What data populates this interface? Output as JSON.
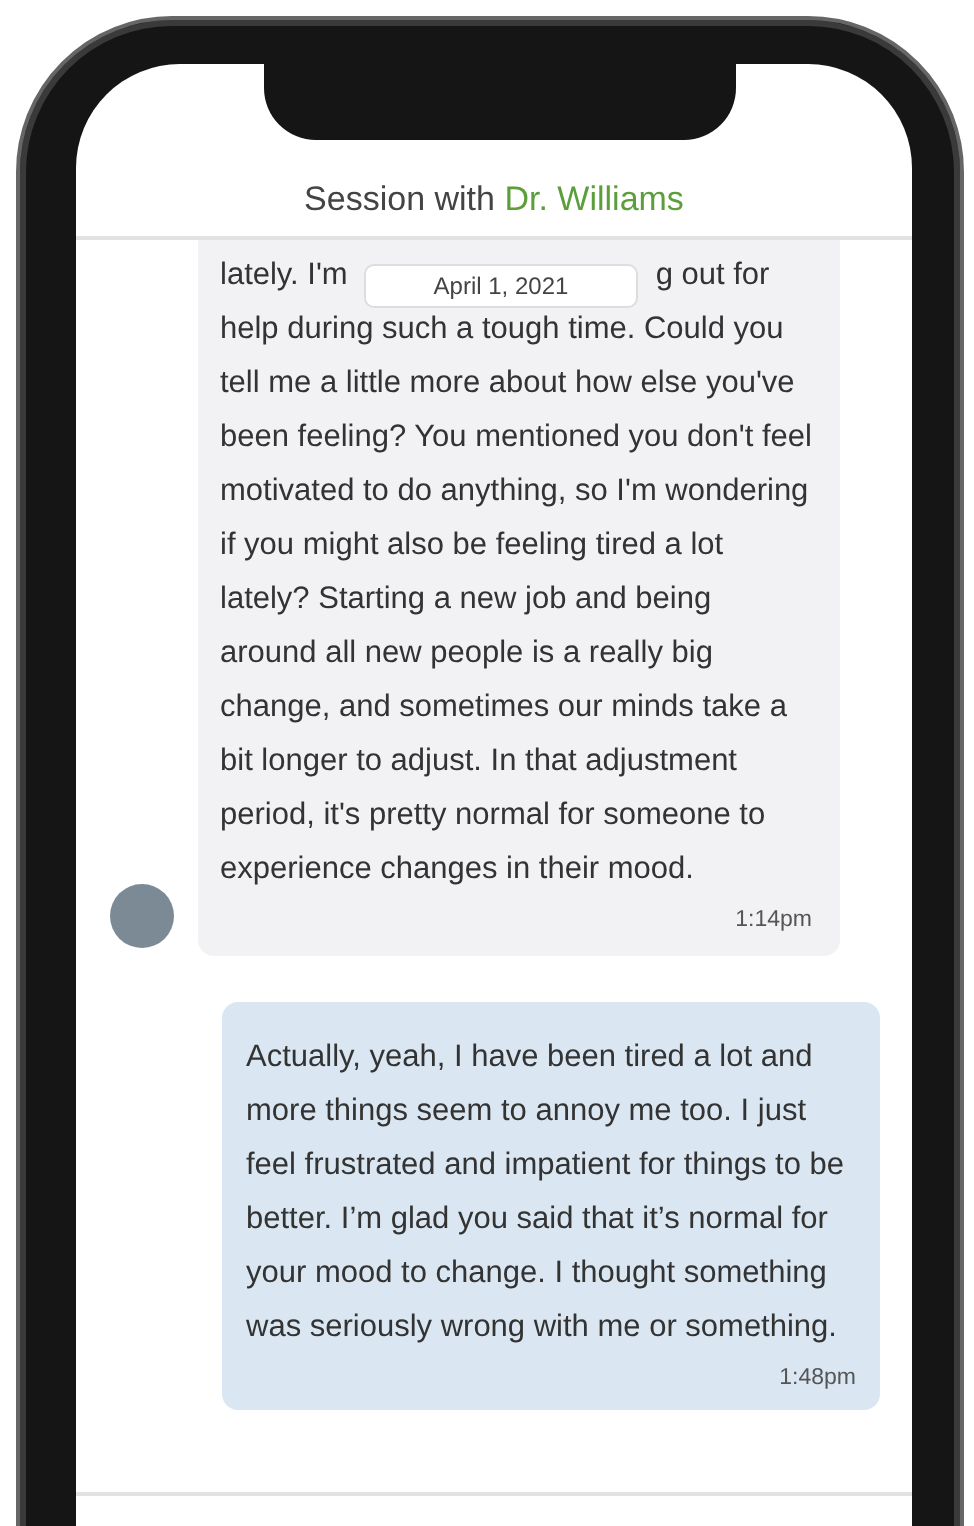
{
  "header": {
    "title": "Session with",
    "name": "Dr. Williams"
  },
  "date_badge": "April 1, 2021",
  "messages": [
    {
      "kind": "received",
      "top_fragments": [
        "lately. I'm",
        "g out for"
      ],
      "text": "help during such a tough time. Could you tell me a little more about how else you've been feeling? You mentioned you don't feel motivated to do anything, so I'm wondering if you might also be feeling tired a lot lately? Starting a new job and being around all new people is a really big change, and sometimes our minds take a bit longer to adjust. In that adjustment period, it's pretty normal for someone to experience changes in their mood.",
      "time": "1:14pm"
    },
    {
      "kind": "sent",
      "text": "Actually, yeah, I have been tired a lot and more things seem to annoy me too. I just feel frustrated and impatient for things to be better. I’m glad you said that it’s normal for your mood to change. I thought something was seriously wrong with me or something.",
      "time": "1:48pm"
    }
  ]
}
